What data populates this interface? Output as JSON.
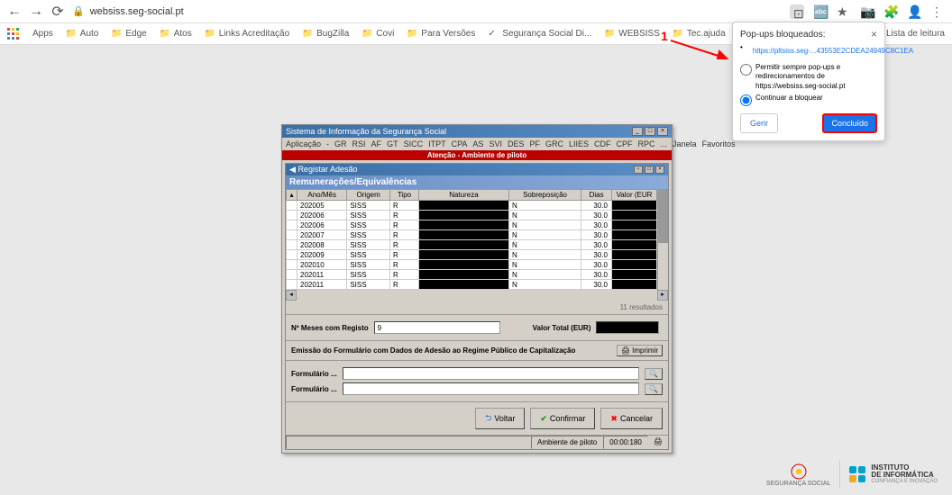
{
  "browser": {
    "url": "websiss.seg-social.pt",
    "bookmarks": [
      "Auto",
      "Edge",
      "Atos",
      "Links Acreditação",
      "BugZilla",
      "Covi",
      "Para Versões",
      "Segurança Social Di...",
      "WEBSISS",
      "Tec.ajuda"
    ],
    "reading_list": "Lista de leitura"
  },
  "popup": {
    "title": "Pop-ups bloqueados:",
    "link": "https://pltsiss.seg-...43553E2CDEA24949C8C1EA",
    "option_allow": "Permitir sempre pop-ups e redirecionamentos de https://websiss.seg-social.pt",
    "option_block": "Continuar a bloquear",
    "btn_manage": "Gerir",
    "btn_done": "Concluído"
  },
  "annotation": {
    "number": "1"
  },
  "app": {
    "title": "Sistema de Informação da Segurança Social",
    "menu": [
      "Aplicação",
      "-",
      "GR",
      "RSI",
      "AF",
      "GT",
      "SICC",
      "ITPT",
      "CPA",
      "AS",
      "SVI",
      "DES",
      "PF",
      "GRC",
      "LIIES",
      "CDF",
      "CPF",
      "RPC",
      "..."
    ],
    "menu_right": [
      "Janela",
      "Favoritos"
    ],
    "banner": "Atenção - Ambiente de piloto",
    "sub_title": "Registar Adesão",
    "section": "Remunerações/Equivalências",
    "columns": [
      "Ano/Mês",
      "Origem",
      "Tipo",
      "Natureza",
      "Sobreposição",
      "Dias",
      "Valor (EUR"
    ],
    "rows": [
      {
        "ano": "202005",
        "origem": "SISS",
        "tipo": "R",
        "sobre": "N",
        "dias": "30.0"
      },
      {
        "ano": "202006",
        "origem": "SISS",
        "tipo": "R",
        "sobre": "N",
        "dias": "30.0"
      },
      {
        "ano": "202006",
        "origem": "SISS",
        "tipo": "R",
        "sobre": "N",
        "dias": "30.0"
      },
      {
        "ano": "202007",
        "origem": "SISS",
        "tipo": "R",
        "sobre": "N",
        "dias": "30.0"
      },
      {
        "ano": "202008",
        "origem": "SISS",
        "tipo": "R",
        "sobre": "N",
        "dias": "30.0"
      },
      {
        "ano": "202009",
        "origem": "SISS",
        "tipo": "R",
        "sobre": "N",
        "dias": "30.0"
      },
      {
        "ano": "202010",
        "origem": "SISS",
        "tipo": "R",
        "sobre": "N",
        "dias": "30.0"
      },
      {
        "ano": "202011",
        "origem": "SISS",
        "tipo": "R",
        "sobre": "N",
        "dias": "30.0"
      },
      {
        "ano": "202011",
        "origem": "SISS",
        "tipo": "R",
        "sobre": "N",
        "dias": "30.0"
      }
    ],
    "result_count": "11 resultados",
    "meses_label": "Nº Meses com Registo",
    "meses_value": "9",
    "valor_total_label": "Valor Total (EUR)",
    "emissao_label": "Emissão do Formulário com Dados de Adesão ao Regime Público de Capitalização",
    "imprimir": "Imprimir",
    "formulario_label": "Formulário ...",
    "btn_voltar": "Voltar",
    "btn_confirmar": "Confirmar",
    "btn_cancelar": "Cancelar",
    "status_env": "Ambiente de piloto",
    "status_time": "00:00:180"
  },
  "footer": {
    "seg": "SEGURANÇA SOCIAL",
    "inst1": "INSTITUTO",
    "inst2": "DE INFORMÁTICA",
    "inst3": "CONFIANÇA E INOVAÇÃO"
  }
}
